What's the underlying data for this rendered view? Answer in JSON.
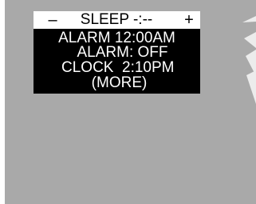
{
  "display": {
    "minus_label": "–",
    "title": "SLEEP -:--",
    "plus_label": "+",
    "lines": [
      "ALARM 12:00AM",
      "ALARM: OFF",
      "CLOCK  2:10PM",
      "(MORE)"
    ]
  },
  "colors": {
    "device_body": "#a9a9a9",
    "screen_bg": "#000000",
    "screen_text": "#ffffff",
    "title_bar_bg": "#ffffff",
    "title_bar_text": "#000000",
    "light_rays": "#e8e8e8"
  }
}
